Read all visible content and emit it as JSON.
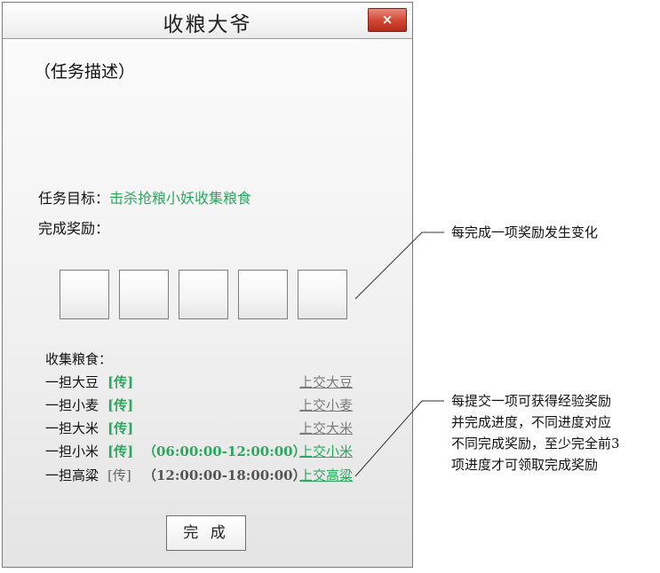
{
  "window": {
    "title": "收粮大爷",
    "close_glyph": "×"
  },
  "task": {
    "description": "（任务描述）",
    "goal_label": "任务目标：",
    "goal_value": "击杀抢粮小妖收集粮食",
    "reward_label": "完成奖励："
  },
  "reward_slots": 5,
  "collect": {
    "label": "收集粮食：",
    "rows": [
      {
        "name": "一担大豆",
        "tag": "[传]",
        "time": "",
        "submit": "上交大豆",
        "active": false
      },
      {
        "name": "一担小麦",
        "tag": "[传]",
        "time": "",
        "submit": "上交小麦",
        "active": false
      },
      {
        "name": "一担大米",
        "tag": "[传]",
        "time": "",
        "submit": "上交大米",
        "active": false
      },
      {
        "name": "一担小米",
        "tag": "[传]",
        "time": "（06:00:00-12:00:00）",
        "submit": "上交小米",
        "active": true
      },
      {
        "name": "一担高粱",
        "tag": "[传]",
        "time": "（12:00:00-18:00:00）",
        "submit": "上交高粱",
        "active": false
      }
    ]
  },
  "done_button": "完 成",
  "annotations": {
    "reward_note": "每完成一项奖励发生变化",
    "submit_note_lines": [
      "每提交一项可获得经验奖励",
      "并完成进度，不同进度对应",
      "不同完成奖励，至少完全前3",
      "项进度才可领取完成奖励"
    ]
  },
  "colors": {
    "accent_green": "#2aa85e",
    "close_red": "#d24a36",
    "muted_gray": "#7a7a7a"
  }
}
